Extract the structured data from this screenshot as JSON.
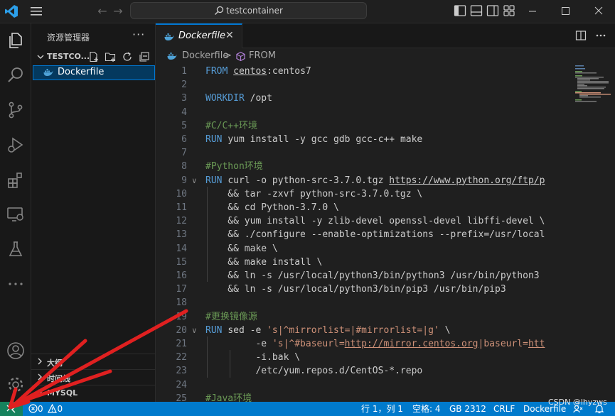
{
  "titlebar": {
    "search_text": "testcontainer"
  },
  "sidebar": {
    "title": "资源管理器",
    "more": "···",
    "folder_name": "TESTCO...",
    "file_name": "Dockerfile",
    "sections": [
      {
        "label": "大纲"
      },
      {
        "label": "时间线"
      },
      {
        "label": "MYSQL"
      }
    ]
  },
  "editor": {
    "tab_label": "Dockerfile",
    "tab_close": "✕",
    "breadcrumb": {
      "file": "Dockerfile",
      "separator": ">",
      "symbol": "FROM"
    },
    "lines": [
      {
        "n": "1",
        "segs": [
          {
            "t": "FROM ",
            "c": "kw"
          },
          {
            "t": "centos",
            "c": "lnk"
          },
          {
            "t": ":centos7",
            "c": ""
          }
        ]
      },
      {
        "n": "2",
        "segs": []
      },
      {
        "n": "3",
        "segs": [
          {
            "t": "WORKDIR ",
            "c": "kw"
          },
          {
            "t": "/opt",
            "c": ""
          }
        ]
      },
      {
        "n": "4",
        "segs": []
      },
      {
        "n": "5",
        "segs": [
          {
            "t": "#C/C++环境",
            "c": "cm"
          }
        ]
      },
      {
        "n": "6",
        "segs": [
          {
            "t": "RUN ",
            "c": "kw"
          },
          {
            "t": "yum install -y gcc gdb gcc-c++ make",
            "c": ""
          }
        ]
      },
      {
        "n": "7",
        "segs": []
      },
      {
        "n": "8",
        "segs": [
          {
            "t": "#Python环境",
            "c": "cm"
          }
        ]
      },
      {
        "n": "9",
        "fold": true,
        "segs": [
          {
            "t": "RUN ",
            "c": "kw"
          },
          {
            "t": "curl -o python-src-3.7.0.tgz ",
            "c": ""
          },
          {
            "t": "https://www.python.org/ftp/p",
            "c": "lnk"
          }
        ]
      },
      {
        "n": "10",
        "segs": [
          {
            "t": "    && tar -zxvf python-src-3.7.0.tgz \\",
            "c": ""
          }
        ]
      },
      {
        "n": "11",
        "segs": [
          {
            "t": "    && cd Python-3.7.0 \\",
            "c": ""
          }
        ]
      },
      {
        "n": "12",
        "segs": [
          {
            "t": "    && yum install -y zlib-devel openssl-devel libffi-devel \\",
            "c": ""
          }
        ]
      },
      {
        "n": "13",
        "segs": [
          {
            "t": "    && ./configure --enable-optimizations --prefix=/usr/local",
            "c": ""
          }
        ]
      },
      {
        "n": "14",
        "segs": [
          {
            "t": "    && make \\",
            "c": ""
          }
        ]
      },
      {
        "n": "15",
        "segs": [
          {
            "t": "    && make install \\",
            "c": ""
          }
        ]
      },
      {
        "n": "16",
        "segs": [
          {
            "t": "    && ln -s /usr/local/python3/bin/python3 /usr/bin/python3",
            "c": ""
          }
        ]
      },
      {
        "n": "17",
        "segs": [
          {
            "t": "    && ln -s /usr/local/python3/bin/pip3 /usr/bin/pip3",
            "c": ""
          }
        ]
      },
      {
        "n": "18",
        "segs": []
      },
      {
        "n": "19",
        "segs": [
          {
            "t": "#更换镜像源",
            "c": "cm"
          }
        ]
      },
      {
        "n": "20",
        "fold": true,
        "segs": [
          {
            "t": "RUN ",
            "c": "kw"
          },
          {
            "t": "sed -e ",
            "c": ""
          },
          {
            "t": "'s|^mirrorlist=|#mirrorlist=|g'",
            "c": "str"
          },
          {
            "t": " \\",
            "c": ""
          }
        ]
      },
      {
        "n": "21",
        "segs": [
          {
            "t": "         -e ",
            "c": ""
          },
          {
            "t": "'s|^#baseurl=",
            "c": "str"
          },
          {
            "t": "http://mirror.centos.org",
            "c": "str lnk"
          },
          {
            "t": "|baseurl=",
            "c": "str"
          },
          {
            "t": "htt",
            "c": "str lnk"
          }
        ]
      },
      {
        "n": "22",
        "segs": [
          {
            "t": "         -i.bak \\",
            "c": ""
          }
        ]
      },
      {
        "n": "23",
        "segs": [
          {
            "t": "         /etc/yum.repos.d/CentOS-*.repo",
            "c": ""
          }
        ]
      },
      {
        "n": "24",
        "segs": []
      },
      {
        "n": "25",
        "segs": [
          {
            "t": "#Java环境",
            "c": "cm"
          }
        ]
      }
    ]
  },
  "statusbar": {
    "errors": "0",
    "warnings": "0",
    "position": "行 1，列 1",
    "spaces": "空格: 4",
    "encoding": "GB 2312",
    "eol": "CRLF",
    "language": "Dockerfile"
  },
  "watermark": "CSDN @lhyzws",
  "colors": {
    "accent": "#007acc",
    "remote": "#16825d",
    "keyword": "#569cd6",
    "comment": "#6a9955",
    "string": "#ce9178",
    "arrow": "#e02020"
  }
}
